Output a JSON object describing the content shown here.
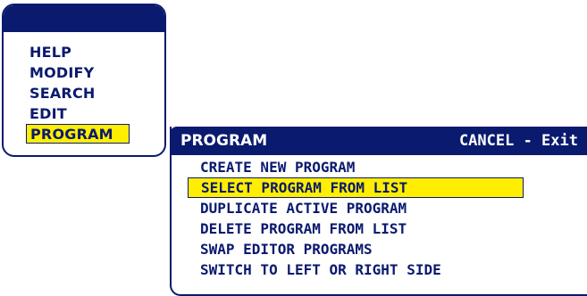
{
  "main_menu": {
    "items": [
      {
        "label": "HELP",
        "selected": false
      },
      {
        "label": "MODIFY",
        "selected": false
      },
      {
        "label": "SEARCH",
        "selected": false
      },
      {
        "label": "EDIT",
        "selected": false
      },
      {
        "label": "PROGRAM",
        "selected": true
      }
    ]
  },
  "sub_menu": {
    "title": "PROGRAM",
    "cancel_hint": "CANCEL - Exit",
    "items": [
      {
        "label": "CREATE NEW PROGRAM",
        "selected": false
      },
      {
        "label": "SELECT PROGRAM FROM LIST",
        "selected": true
      },
      {
        "label": "DUPLICATE ACTIVE PROGRAM",
        "selected": false
      },
      {
        "label": "DELETE PROGRAM FROM LIST",
        "selected": false
      },
      {
        "label": "SWAP EDITOR PROGRAMS",
        "selected": false
      },
      {
        "label": "SWITCH TO LEFT OR RIGHT SIDE",
        "selected": false
      }
    ]
  },
  "colors": {
    "primary": "#0a1a6e",
    "highlight": "#ffee00",
    "background": "#ffffff"
  }
}
